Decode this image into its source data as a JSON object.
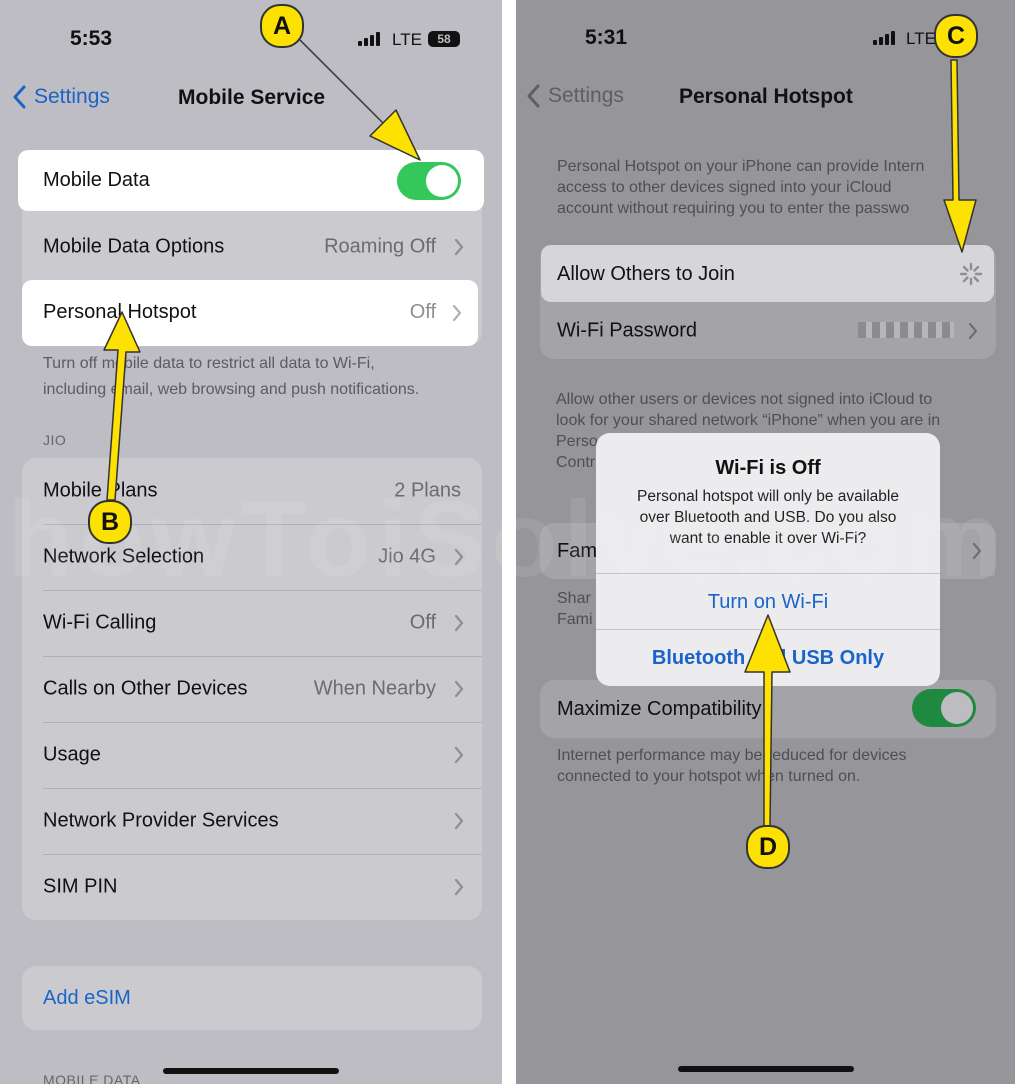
{
  "colors": {
    "accent": "#1a64c9",
    "toggle_on": "#34c759",
    "annotation": "#fde100"
  },
  "watermark": "howToiSolve.com",
  "left": {
    "status": {
      "time": "5:53",
      "network": "LTE",
      "battery": "58"
    },
    "nav": {
      "back_label": "Settings",
      "title": "Mobile Service"
    },
    "mobile_data": {
      "label": "Mobile Data",
      "toggle_on": true
    },
    "mobile_data_options": {
      "label": "Mobile Data Options",
      "value": "Roaming Off"
    },
    "personal_hotspot": {
      "label": "Personal Hotspot",
      "value": "Off"
    },
    "caption_line1": "Turn off mobile data to restrict all data to Wi-Fi,",
    "caption_line2": "including email, web browsing and push notifications.",
    "section_jio": "JIO",
    "jio_rows": [
      {
        "label": "Mobile Plans",
        "value": "2 Plans"
      },
      {
        "label": "Network Selection",
        "value": "Jio 4G"
      },
      {
        "label": "Wi-Fi Calling",
        "value": "Off"
      },
      {
        "label": "Calls on Other Devices",
        "value": "When Nearby"
      },
      {
        "label": "Usage",
        "value": ""
      },
      {
        "label": "Network Provider Services",
        "value": ""
      },
      {
        "label": "SIM PIN",
        "value": ""
      }
    ],
    "add_esim": "Add eSIM",
    "section_mobile_data": "MOBILE DATA"
  },
  "right": {
    "status": {
      "time": "5:31",
      "network": "LTE"
    },
    "nav": {
      "back_label": "Settings",
      "title": "Personal Hotspot"
    },
    "intro_line1": "Personal Hotspot on your iPhone can provide Intern",
    "intro_line2": "access to other devices signed into your iCloud",
    "intro_line3": "account without requiring you to enter the passwo",
    "allow_others": "Allow Others to Join",
    "wifi_password": "Wi-Fi Password",
    "info_line1": "Allow other users or devices not signed into iCloud to",
    "info_line2": "look for your shared network “iPhone” when you are in",
    "info_line3": "Perso",
    "info_line4": "Contr",
    "family_row": "Fam",
    "family_line1": "Shar",
    "family_line2": "Fami",
    "maximize": "Maximize Compatibility",
    "maximize_on": true,
    "perf_line1": "Internet performance may be reduced for devices",
    "perf_line2": "connected to your hotspot when turned on.",
    "dialog": {
      "title": "Wi-Fi is Off",
      "msg_line1": "Personal hotspot will only be available",
      "msg_line2": "over Bluetooth and USB. Do you also",
      "msg_line3": "want to enable it over Wi-Fi?",
      "primary": "Turn on Wi-Fi",
      "secondary": "Bluetooth and USB Only"
    }
  },
  "annotations": {
    "a": "A",
    "b": "B",
    "c": "C",
    "d": "D"
  }
}
